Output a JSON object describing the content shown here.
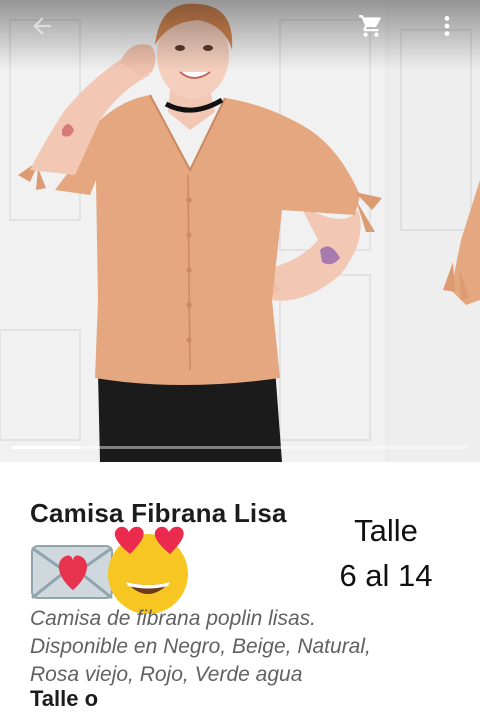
{
  "product": {
    "title": "Camisa Fibrana Lisa",
    "size_line1": "Talle",
    "size_line2": "6 al 14",
    "description_lines": [
      "Camisa de fibrana poplin lisas.",
      "Disponible en Negro, Beige, Natural,",
      "Rosa viejo, Rojo, Verde agua"
    ],
    "truncated_line": "Talle                  o"
  },
  "icons": {
    "back": "arrow-left-icon",
    "cart": "shopping-cart-icon",
    "menu": "more-vertical-icon",
    "love_letter": "love-letter-emoji",
    "heart_eyes": "heart-eyes-emoji"
  },
  "gallery": {
    "progress": 0.15
  },
  "colors": {
    "shirt": "#e5a77f",
    "pants": "#1b1b1b",
    "wall": "#efefef"
  }
}
